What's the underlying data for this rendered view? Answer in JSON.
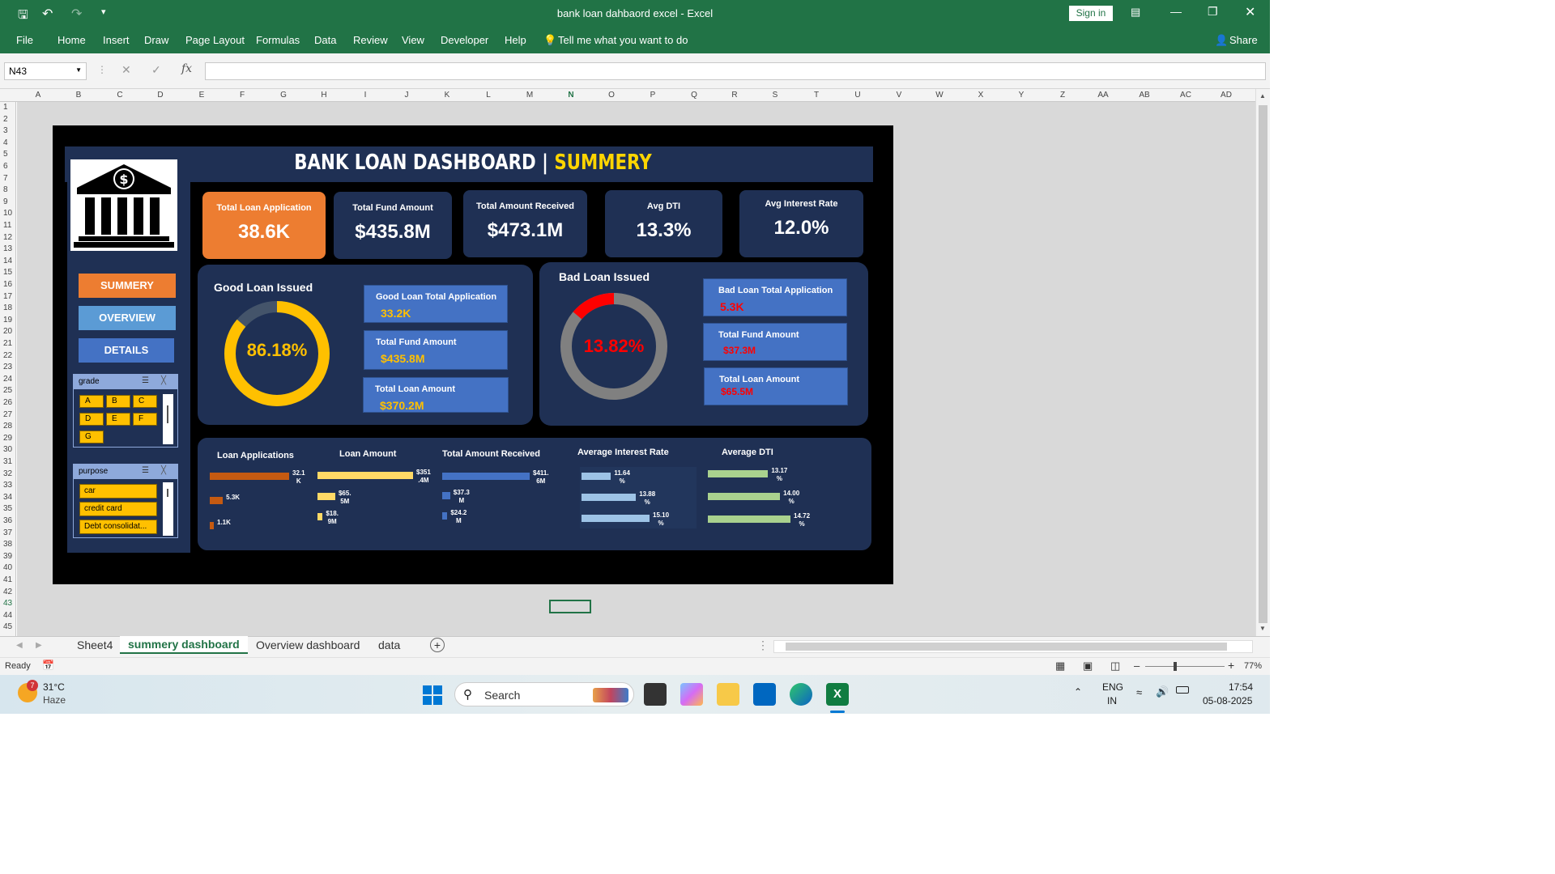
{
  "window": {
    "title": "bank loan dahbaord excel  -  Excel",
    "signin": "Sign in",
    "share": "Share"
  },
  "ribbon": {
    "menus": [
      "File",
      "Home",
      "Insert",
      "Draw",
      "Page Layout",
      "Formulas",
      "Data",
      "Review",
      "View",
      "Developer",
      "Help"
    ],
    "tell": "Tell me what you want to do"
  },
  "formula": {
    "namebox": "N43",
    "value": ""
  },
  "columns": [
    "A",
    "B",
    "C",
    "D",
    "E",
    "F",
    "G",
    "H",
    "I",
    "J",
    "K",
    "L",
    "M",
    "N",
    "O",
    "P",
    "Q",
    "R",
    "S",
    "T",
    "U",
    "V",
    "W",
    "X",
    "Y",
    "Z",
    "AA",
    "AB",
    "AC",
    "AD"
  ],
  "rows": [
    "1",
    "2",
    "3",
    "4",
    "5",
    "6",
    "7",
    "8",
    "9",
    "10",
    "11",
    "12",
    "13",
    "14",
    "15",
    "16",
    "17",
    "18",
    "19",
    "20",
    "21",
    "22",
    "23",
    "24",
    "25",
    "26",
    "27",
    "28",
    "29",
    "30",
    "31",
    "32",
    "33",
    "34",
    "35",
    "36",
    "37",
    "38",
    "39",
    "40",
    "41",
    "42",
    "43",
    "44",
    "45"
  ],
  "dashboard": {
    "title_a": "BANK LOAN DASHBOARD | ",
    "title_b": "SUMMERY",
    "kpis": [
      {
        "title": "Total Loan Application",
        "value": "38.6K"
      },
      {
        "title": "Total Fund Amount",
        "value": "$435.8M"
      },
      {
        "title": "Total Amount Received",
        "value": "$473.1M"
      },
      {
        "title": "Avg DTI",
        "value": "13.3%"
      },
      {
        "title": "Avg Interest Rate",
        "value": "12.0%"
      }
    ],
    "nav": {
      "summery": "SUMMERY",
      "overview": "OVERVIEW",
      "details": "DETAILS"
    },
    "slicer_grade": {
      "title": "grade",
      "items": [
        "A",
        "B",
        "C",
        "D",
        "E",
        "F",
        "G"
      ]
    },
    "slicer_purpose": {
      "title": "purpose",
      "items": [
        "car",
        "credit card",
        "Debt consolidat..."
      ]
    },
    "good": {
      "title": "Good Loan Issued",
      "pct": "86.18%",
      "fraction": 0.8618,
      "boxes": [
        {
          "t": "Good Loan Total Application",
          "v": "33.2K"
        },
        {
          "t": "Total Fund Amount",
          "v": "$435.8M"
        },
        {
          "t": "Total  Loan Amount",
          "v": "$370.2M"
        }
      ]
    },
    "bad": {
      "title": "Bad Loan Issued",
      "pct": "13.82%",
      "fraction": 0.1382,
      "boxes": [
        {
          "t": "Bad Loan Total Application",
          "v": "5.3K"
        },
        {
          "t": "Total Fund Amount",
          "v": "$37.3M"
        },
        {
          "t": "Total Loan Amount",
          "v": "$65.5M"
        }
      ]
    },
    "minis": [
      {
        "title": "Loan Applications",
        "color": "#c55a11",
        "values": [
          32.1,
          5.3,
          1.1
        ],
        "labels": [
          "32.1\nK",
          "5.3K",
          "1.1K"
        ]
      },
      {
        "title": "Loan Amount",
        "color": "#ffd966",
        "values": [
          351.4,
          65.5,
          18.9
        ],
        "labels": [
          "$351\n.4M",
          "$65.\n5M",
          "$18.\n9M"
        ]
      },
      {
        "title": "Total Amount  Received",
        "color": "#4472c4",
        "values": [
          411.6,
          37.3,
          24.2
        ],
        "labels": [
          "$411.\n6M",
          "$37.3\nM",
          "$24.2\nM"
        ]
      },
      {
        "title": "Average Interest Rate",
        "color": "#9dc3e6",
        "values": [
          11.64,
          13.88,
          15.1
        ],
        "labels": [
          "11.64\n%",
          "13.88\n%",
          "15.10\n%"
        ]
      },
      {
        "title": "Average DTI",
        "color": "#a9d18e",
        "values": [
          13.17,
          14.0,
          14.72
        ],
        "labels": [
          "13.17\n%",
          "14.00\n%",
          "14.72\n%"
        ]
      }
    ]
  },
  "sheets": [
    "Sheet4",
    "summery dashboard",
    "Overview dashboard",
    "data"
  ],
  "status": {
    "ready": "Ready",
    "zoom": "77%"
  },
  "taskbar": {
    "temp": "31°C",
    "weather": "Haze",
    "badge": "7",
    "search": "Search",
    "lang1": "ENG",
    "lang2": "IN",
    "time": "17:54",
    "date": "05-08-2025"
  }
}
